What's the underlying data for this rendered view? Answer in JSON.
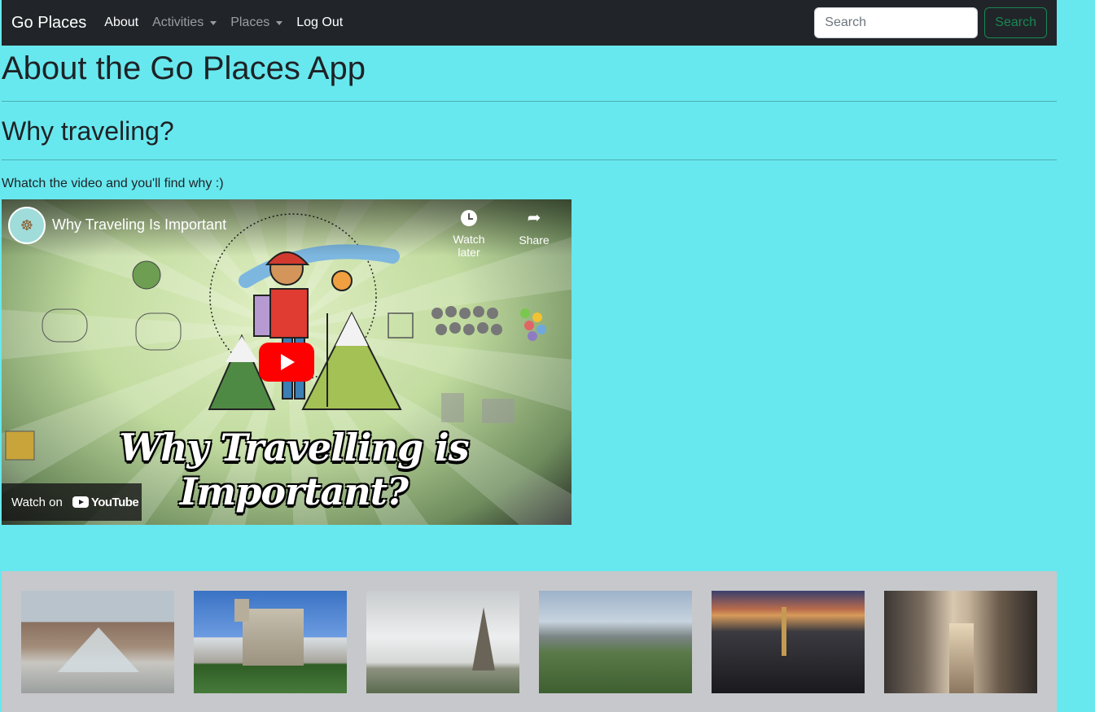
{
  "navbar": {
    "brand": "Go Places",
    "links": [
      {
        "label": "About",
        "active": true,
        "dropdown": false
      },
      {
        "label": "Activities",
        "active": false,
        "dropdown": true
      },
      {
        "label": "Places",
        "active": false,
        "dropdown": true
      },
      {
        "label": "Log Out",
        "active": true,
        "dropdown": false
      }
    ],
    "search_placeholder": "Search",
    "search_button": "Search"
  },
  "main": {
    "title": "About the Go Places App",
    "subtitle": "Why traveling?",
    "intro": "Whatch the video and you'll find why :)"
  },
  "video": {
    "title": "Why Traveling Is Important",
    "watch_later": "Watch later",
    "share": "Share",
    "banner": "Why Travelling is Important?",
    "watch_on": "Watch on",
    "platform": "YouTube"
  },
  "gallery": {
    "items": [
      {
        "name": "louvre-thumbnail"
      },
      {
        "name": "notre-dame-thumbnail"
      },
      {
        "name": "eiffel-tower-thumbnail"
      },
      {
        "name": "city-panorama-thumbnail"
      },
      {
        "name": "skyline-sunset-thumbnail"
      },
      {
        "name": "paris-street-thumbnail"
      }
    ]
  },
  "colors": {
    "page_background": "#67e8ee",
    "navbar": "#212529",
    "search_button": "#198754",
    "gallery_background": "#c7c8cb",
    "play_button": "#ff0000"
  }
}
